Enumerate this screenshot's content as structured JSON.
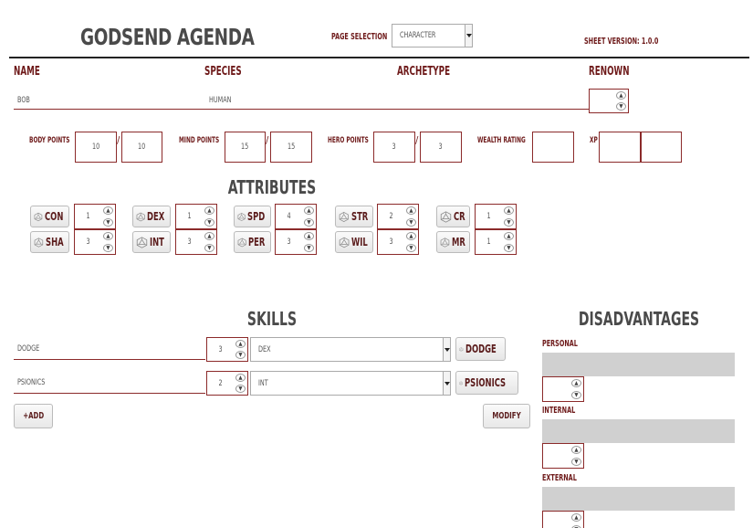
{
  "app": {
    "title": "GODSEND AGENDA",
    "sheet_version": "SHEET VERSION: 1.0.0"
  },
  "page_selection": {
    "label": "PAGE SELECTION",
    "value": "CHARACTER"
  },
  "header": {
    "name_label": "NAME",
    "species_label": "SPECIES",
    "archetype_label": "ARCHETYPE",
    "renown_label": "RENOWN",
    "name_value": "BOB",
    "species_value": "HUMAN",
    "archetype_value": "",
    "renown_value": ""
  },
  "points": {
    "body_label": "BODY POINTS",
    "body_current": "10",
    "body_max": "10",
    "mind_label": "MIND POINTS",
    "mind_current": "15",
    "mind_max": "15",
    "hero_label": "HERO POINTS",
    "hero_current": "3",
    "hero_max": "3",
    "wealth_label": "WEALTH RATING",
    "wealth_value": "",
    "xp_label": "XP",
    "xp_current": "",
    "xp_max": "",
    "separator": "/"
  },
  "attributes": {
    "title": "ATTRIBUTES",
    "items": [
      {
        "label": "CON",
        "value": "1"
      },
      {
        "label": "DEX",
        "value": "1"
      },
      {
        "label": "SPD",
        "value": "4"
      },
      {
        "label": "STR",
        "value": "2"
      },
      {
        "label": "CR",
        "value": "1"
      },
      {
        "label": "SHA",
        "value": "3"
      },
      {
        "label": "INT",
        "value": "3"
      },
      {
        "label": "PER",
        "value": "3"
      },
      {
        "label": "WIL",
        "value": "3"
      },
      {
        "label": "MR",
        "value": "1"
      }
    ]
  },
  "skills": {
    "title": "SKILLS",
    "rows": [
      {
        "name": "DODGE",
        "value": "3",
        "attribute": "DEX",
        "roll_label": "DODGE"
      },
      {
        "name": "PSIONICS",
        "value": "2",
        "attribute": "INT",
        "roll_label": "PSIONICS"
      }
    ],
    "add_label": "+ADD",
    "modify_label": "MODIFY"
  },
  "disadvantages": {
    "title": "DISADVANTAGES",
    "groups": [
      {
        "label": "PERSONAL",
        "value": ""
      },
      {
        "label": "INTERNAL",
        "value": ""
      },
      {
        "label": "EXTERNAL",
        "value": ""
      }
    ]
  },
  "icons": {
    "spinner_up": "▲",
    "spinner_down": "▼",
    "dice": "d20-icon"
  },
  "colors": {
    "accent": "#6e1a1a",
    "border": "#8b2a2a",
    "title": "#4a4a4a",
    "field_gray": "#d0d0d0"
  }
}
